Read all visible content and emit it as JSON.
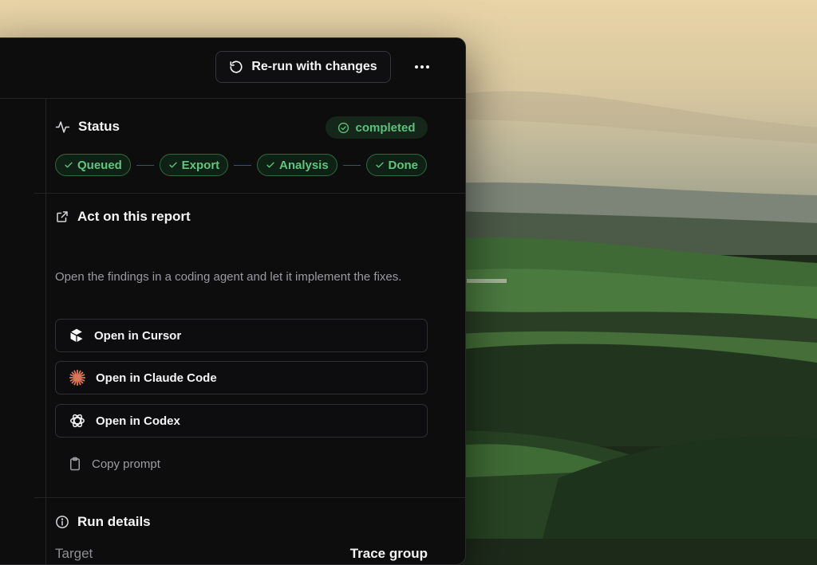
{
  "toolbar": {
    "rerun_label": "Re-run with changes",
    "more_icon": "more-horizontal-icon"
  },
  "status": {
    "title": "Status",
    "badge": "completed",
    "steps": [
      "Queued",
      "Export",
      "Analysis",
      "Done"
    ]
  },
  "act": {
    "title": "Act on this report",
    "description": "Open the findings in a coding agent and let it implement the fixes.",
    "buttons": {
      "cursor": "Open in Cursor",
      "claude": "Open in Claude Code",
      "codex": "Open in Codex"
    },
    "copy_prompt": "Copy prompt"
  },
  "run_details": {
    "title": "Run details",
    "rows": [
      {
        "label": "Target",
        "value": "Trace group"
      }
    ]
  },
  "colors": {
    "accent_green": "#5fc07a",
    "panel_bg": "#0d0d0e",
    "claude_orange": "#d97757"
  }
}
